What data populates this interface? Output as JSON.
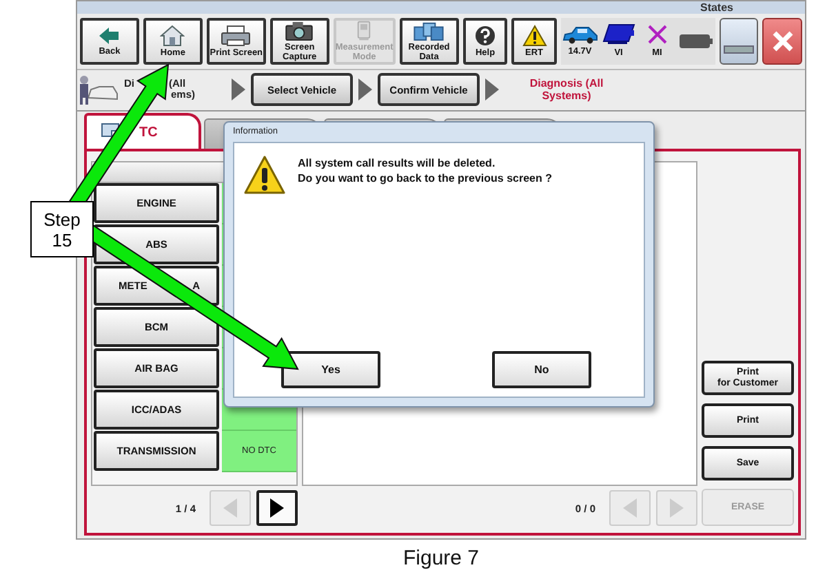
{
  "title_strip": {
    "label": "States"
  },
  "toolbar": [
    {
      "label": "Back",
      "disabled": false
    },
    {
      "label": "Home",
      "disabled": false
    },
    {
      "label": "Print Screen",
      "disabled": false
    },
    {
      "label": "Screen\nCapture",
      "disabled": false
    },
    {
      "label": "Measurement\nMode",
      "disabled": true
    },
    {
      "label": "Recorded\nData",
      "disabled": false
    },
    {
      "label": "Help",
      "disabled": false
    },
    {
      "label": "ERT",
      "disabled": false
    }
  ],
  "status": [
    {
      "label": "14.7V"
    },
    {
      "label": "VI"
    },
    {
      "label": "MI"
    }
  ],
  "window_controls": [
    {
      "kind": "minimize"
    },
    {
      "kind": "close"
    }
  ],
  "breadcrumb": {
    "current_lines": [
      [
        "Di",
        "(All"
      ],
      [
        "ems)"
      ]
    ],
    "steps": [
      "Select Vehicle",
      "Confirm Vehicle"
    ],
    "target": "Diagnosis (All Systems)"
  },
  "tabs": [
    {
      "label": "TC",
      "selected": true
    },
    {
      "selected": false
    },
    {
      "selected": false
    },
    {
      "selected": false
    }
  ],
  "systems": [
    {
      "name": "ENGINE"
    },
    {
      "name": "ABS"
    },
    {
      "name": [
        "METE",
        "A"
      ]
    },
    {
      "name": "BCM"
    },
    {
      "name": "AIR BAG"
    },
    {
      "name": "ICC/ADAS"
    },
    {
      "name": "TRANSMISSION",
      "result": "NO DTC"
    }
  ],
  "system_pager": {
    "page": "1 / 4",
    "prev_disabled": true,
    "next_disabled": false
  },
  "results_pager": {
    "page": "0 / 0",
    "prev_disabled": true,
    "next_disabled": true
  },
  "side_buttons": [
    {
      "label": "Print\nfor Customer",
      "disabled": false
    },
    {
      "label": "Print",
      "disabled": false
    },
    {
      "label": "Save",
      "disabled": false
    },
    {
      "label": "ERASE",
      "disabled": true
    }
  ],
  "dialog": {
    "title": "Information",
    "message": "All system call results will be deleted.\nDo you want to go back to the previous screen ?",
    "buttons": [
      "Yes",
      "No"
    ]
  },
  "annotation": {
    "label": "Step 15"
  },
  "caption": "Figure 7"
}
